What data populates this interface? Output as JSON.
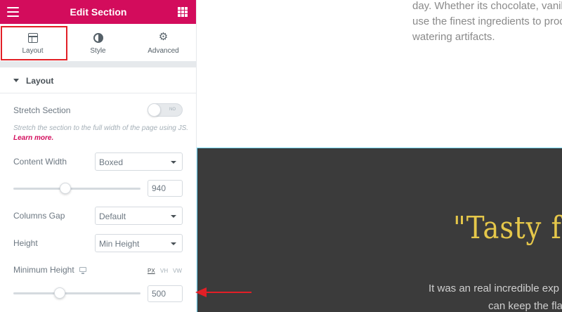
{
  "panel": {
    "title": "Edit Section",
    "tabs": [
      {
        "label": "Layout",
        "icon": "layout-icon",
        "active": true
      },
      {
        "label": "Style",
        "icon": "style-icon"
      },
      {
        "label": "Advanced",
        "icon": "gear-icon"
      }
    ]
  },
  "layout": {
    "section_title": "Layout",
    "stretch": {
      "label": "Stretch Section",
      "toggle": "NO",
      "help": "Stretch the section to the full width of the page using JS.",
      "learn_more": "Learn more."
    },
    "content_width": {
      "label": "Content Width",
      "value": "Boxed"
    },
    "width_value": "940",
    "width_slider_fraction": 0.4,
    "columns_gap": {
      "label": "Columns Gap",
      "value": "Default"
    },
    "height": {
      "label": "Height",
      "value": "Min Height"
    },
    "min_height": {
      "label": "Minimum Height",
      "units": [
        "PX",
        "VH",
        "VW"
      ],
      "active_unit": "PX"
    },
    "min_height_value": "500",
    "min_height_slider_fraction": 0.35
  },
  "preview": {
    "top_lines": [
      "day. Whether its chocolate, vanill",
      "use the finest ingredients to prod",
      "watering artifacts."
    ],
    "heading": "\"Tasty fo",
    "body_lines": [
      "It was an real incredible exp",
      "can keep the fla"
    ]
  },
  "colors": {
    "brand": "#d30c5c",
    "annotation": "#e21f26",
    "dark_section": "#3b3b3b",
    "heading": "#e5c74a",
    "selection_outline": "#71d7f7"
  }
}
